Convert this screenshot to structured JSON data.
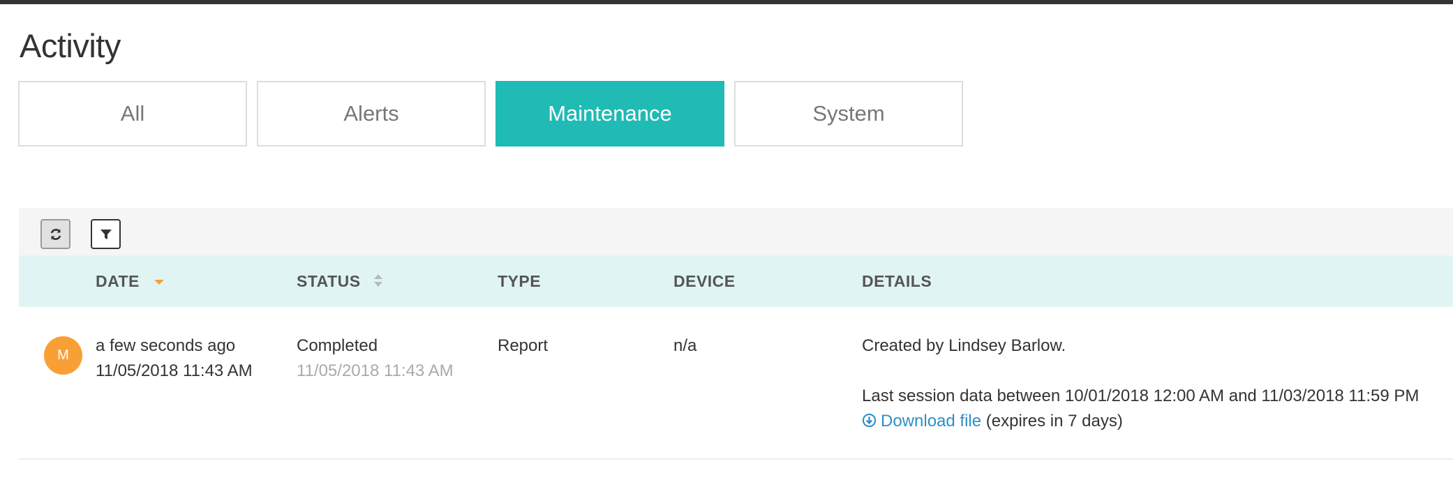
{
  "page": {
    "title": "Activity"
  },
  "tabs": [
    {
      "label": "All",
      "active": false
    },
    {
      "label": "Alerts",
      "active": false
    },
    {
      "label": "Maintenance",
      "active": true
    },
    {
      "label": "System",
      "active": false
    }
  ],
  "toolbar": {
    "refresh_icon": "refresh-icon",
    "filter_icon": "filter-icon"
  },
  "table": {
    "columns": [
      "DATE",
      "STATUS",
      "TYPE",
      "DEVICE",
      "DETAILS"
    ],
    "sort": {
      "column": "DATE",
      "direction": "descending"
    },
    "rows": [
      {
        "avatar": "M",
        "date_relative": "a few seconds ago",
        "date_absolute": "11/05/2018 11:43 AM",
        "status": "Completed",
        "status_date": "11/05/2018 11:43 AM",
        "type": "Report",
        "device": "n/a",
        "details_created": "Created by Lindsey Barlow.",
        "details_range": "Last session data between 10/01/2018 12:00 AM and 11/03/2018 11:59 PM",
        "download_label": "Download file",
        "download_note": "(expires in 7 days)"
      }
    ]
  },
  "colors": {
    "accent": "#1fbbb4",
    "header_bg": "#e0f5f3",
    "avatar": "#f8a036",
    "link": "#2d8fc8",
    "sort_active": "#f8a036"
  }
}
